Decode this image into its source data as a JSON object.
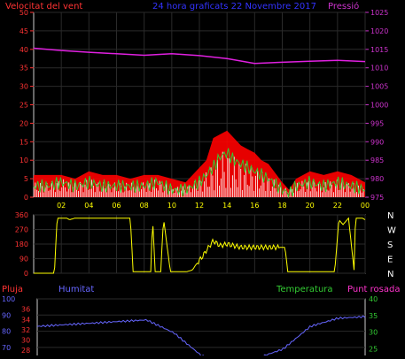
{
  "chart_data": [
    {
      "type": "line",
      "title": "24 hora graficats   22 Novembre 2017",
      "left_axis_label": "Velocitat del vent",
      "right_axis_label": "Pressió",
      "ylim_left": [
        0,
        50
      ],
      "ylim_right": [
        975,
        1025
      ],
      "y_ticks_left": [
        0,
        5,
        10,
        15,
        20,
        25,
        30,
        35,
        40,
        45,
        50
      ],
      "y_ticks_right": [
        975,
        980,
        985,
        990,
        995,
        1000,
        1005,
        1010,
        1015,
        1020,
        1025
      ],
      "x_ticks": [
        "02",
        "04",
        "06",
        "08",
        "10",
        "12",
        "14",
        "16",
        "18",
        "20",
        "22",
        "00"
      ],
      "xlim": [
        0,
        24
      ],
      "grid": true,
      "colors": {
        "gust": "#ff0000",
        "average": "#33cc33",
        "direction_bars": "#ffffff",
        "pressure": "#e020e0",
        "left_axis": "#ff3333",
        "right_axis": "#cc33cc",
        "title": "#3333ff"
      },
      "series": [
        {
          "name": "Pressió",
          "axis": "right",
          "x": [
            0,
            2,
            4,
            6,
            8,
            10,
            12,
            14,
            16,
            18,
            20,
            22,
            24
          ],
          "values": [
            1015.3,
            1014.7,
            1014.2,
            1013.8,
            1013.4,
            1013.8,
            1013.3,
            1012.5,
            1011.2,
            1011.5,
            1011.8,
            1012.0,
            1011.7
          ]
        },
        {
          "name": "gust",
          "axis": "left",
          "x": [
            0,
            1,
            2,
            3,
            4,
            5,
            6,
            7,
            8,
            9,
            10,
            11,
            12,
            12.5,
            13,
            13.5,
            14,
            14.5,
            15,
            15.5,
            16,
            16.5,
            17,
            18,
            18.5,
            19,
            20,
            21,
            22,
            23,
            24
          ],
          "values": [
            6,
            6,
            6,
            5,
            7,
            6,
            6,
            5,
            6,
            6,
            5,
            4,
            8,
            10,
            16,
            17,
            18,
            16,
            14,
            13,
            12,
            10,
            9,
            4,
            2,
            5,
            7,
            6,
            7,
            6,
            4
          ]
        },
        {
          "name": "average",
          "axis": "left",
          "x": [
            0,
            1,
            2,
            3,
            4,
            5,
            6,
            7,
            8,
            9,
            10,
            11,
            12,
            12.5,
            13,
            13.5,
            14,
            14.5,
            15,
            15.5,
            16,
            16.5,
            17,
            18,
            18.5,
            19,
            20,
            21,
            22,
            23,
            24
          ],
          "values": [
            3,
            3,
            4,
            3,
            4,
            3,
            3,
            3,
            3,
            4,
            2,
            2,
            4,
            6,
            8,
            11,
            12,
            10,
            9,
            8,
            7,
            6,
            5,
            2,
            1,
            3,
            4,
            3,
            4,
            3,
            2
          ]
        }
      ]
    },
    {
      "type": "line",
      "title": "",
      "right_labels": [
        "N",
        "W",
        "S",
        "E",
        "N"
      ],
      "ylim": [
        0,
        360
      ],
      "y_ticks": [
        0,
        90,
        180,
        270,
        360
      ],
      "xlim": [
        0,
        24
      ],
      "grid": true,
      "colors": {
        "direction": "#ffff00",
        "axis": "#ff3333"
      },
      "series": [
        {
          "name": "direction",
          "x": [
            0,
            1.5,
            1.7,
            2.4,
            2.6,
            3.0,
            5.0,
            7.0,
            7.2,
            8.5,
            8.6,
            8.8,
            9.2,
            9.4,
            9.9,
            10.0,
            10.7,
            11.1,
            11.5,
            11.8,
            12.2,
            12.5,
            13.0,
            13.5,
            14.0,
            14.5,
            15.0,
            16.0,
            17.0,
            18.0,
            18.2,
            18.4,
            21.8,
            22.1,
            22.4,
            22.8,
            23.2,
            23.3,
            23.8,
            24
          ],
          "values": [
            0,
            0,
            340,
            340,
            330,
            340,
            340,
            340,
            10,
            10,
            360,
            10,
            10,
            340,
            10,
            10,
            10,
            10,
            20,
            60,
            100,
            140,
            200,
            170,
            180,
            170,
            160,
            160,
            160,
            160,
            160,
            10,
            10,
            330,
            300,
            340,
            20,
            340,
            340,
            330
          ]
        }
      ]
    },
    {
      "type": "line",
      "title": "",
      "legend": [
        "Pluja",
        "Humitat",
        "Temperatura",
        "Punt rosada"
      ],
      "left_ticks_outer": [
        70,
        80,
        90,
        100
      ],
      "left_ticks_inner": [
        28,
        30,
        32,
        34,
        36,
        38
      ],
      "right_ticks": [
        25,
        30,
        35,
        40
      ],
      "colors": {
        "pluja": "#ff3333",
        "humitat": "#6666ff",
        "temperatura": "#33cc33",
        "punt_rosada": "#ff33cc"
      },
      "series": [
        {
          "name": "Humitat",
          "x": [
            0,
            2,
            4,
            6,
            8,
            10,
            12,
            14,
            16,
            18,
            20,
            22,
            24
          ],
          "values": [
            83,
            84,
            85,
            86,
            87,
            79,
            65,
            60,
            63,
            69,
            83,
            88,
            89
          ]
        }
      ]
    }
  ]
}
